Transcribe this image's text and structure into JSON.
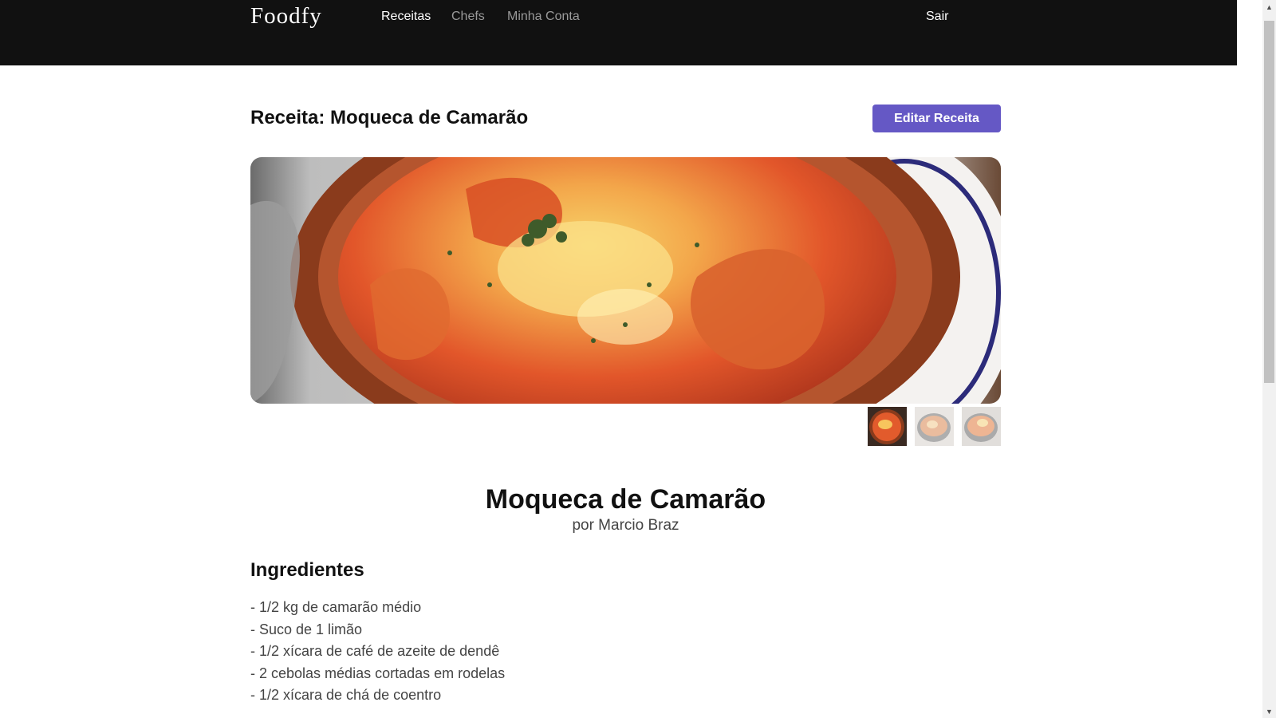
{
  "header": {
    "brand": "Foodfy",
    "nav": {
      "recipes": "Receitas",
      "chefs": "Chefs",
      "account": "Minha Conta"
    },
    "logout": "Sair"
  },
  "page": {
    "title": "Receita: Moqueca de Camarão",
    "edit_button": "Editar Receita"
  },
  "gallery": {
    "main_image": "moqueca-photo",
    "thumbnails": [
      "moqueca-thumb-1",
      "moqueca-thumb-2",
      "moqueca-thumb-3"
    ]
  },
  "recipe": {
    "name": "Moqueca de Camarão",
    "author": "por Marcio Braz",
    "ingredients_title": "Ingredientes",
    "ingredients": [
      "- 1/2 kg de camarão médio",
      "- Suco de 1 limão",
      "- 1/2 xícara de café de azeite de dendê",
      "- 2 cebolas médias cortadas em rodelas",
      "- 1/2 xícara de chá de coentro"
    ]
  },
  "colors": {
    "header_bg": "#111111",
    "accent": "#6558c5"
  }
}
